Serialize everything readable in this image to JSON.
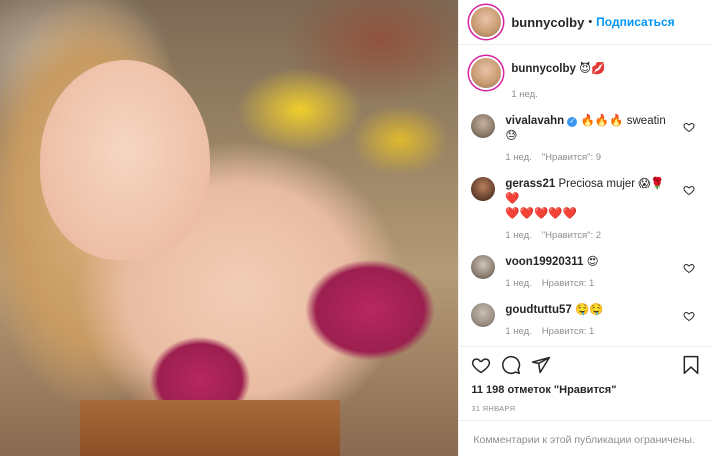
{
  "post": {
    "author": "bunnycolby",
    "separator": "•",
    "follow_label": "Подписаться",
    "caption_user": "bunnycolby",
    "caption_text": "😈💋",
    "caption_time": "1 нед."
  },
  "comments": [
    {
      "user": "vivalavahn",
      "verified": true,
      "text": "🔥🔥🔥 sweatin 😓",
      "time": "1 нед.",
      "likes": "\"Нравится\": 9"
    },
    {
      "user": "gerass21",
      "verified": false,
      "text": "Preciosa mujer 😱🌹❤️\n❤️❤️❤️❤️❤️",
      "time": "1 нед.",
      "likes": "\"Нравится\": 2"
    },
    {
      "user": "voon19920311",
      "verified": false,
      "text": "😍",
      "time": "1 нед.",
      "likes": "Нравится: 1"
    },
    {
      "user": "goudtuttu57",
      "verified": false,
      "text": "🤤🤤",
      "time": "1 нед.",
      "likes": "Нравится: 1"
    }
  ],
  "actions": {
    "like_icon": "heart-icon",
    "comment_icon": "comment-icon",
    "share_icon": "share-icon",
    "save_icon": "bookmark-icon"
  },
  "likes_text": "11 198 отметок \"Нравится\"",
  "date": "31 ЯНВАРЯ",
  "comments_restricted": "Комментарии к этой публикации ограничены.",
  "colors": {
    "link": "#0095f6",
    "muted": "#8e8e8e",
    "text": "#262626",
    "verified": "#3897f0"
  }
}
